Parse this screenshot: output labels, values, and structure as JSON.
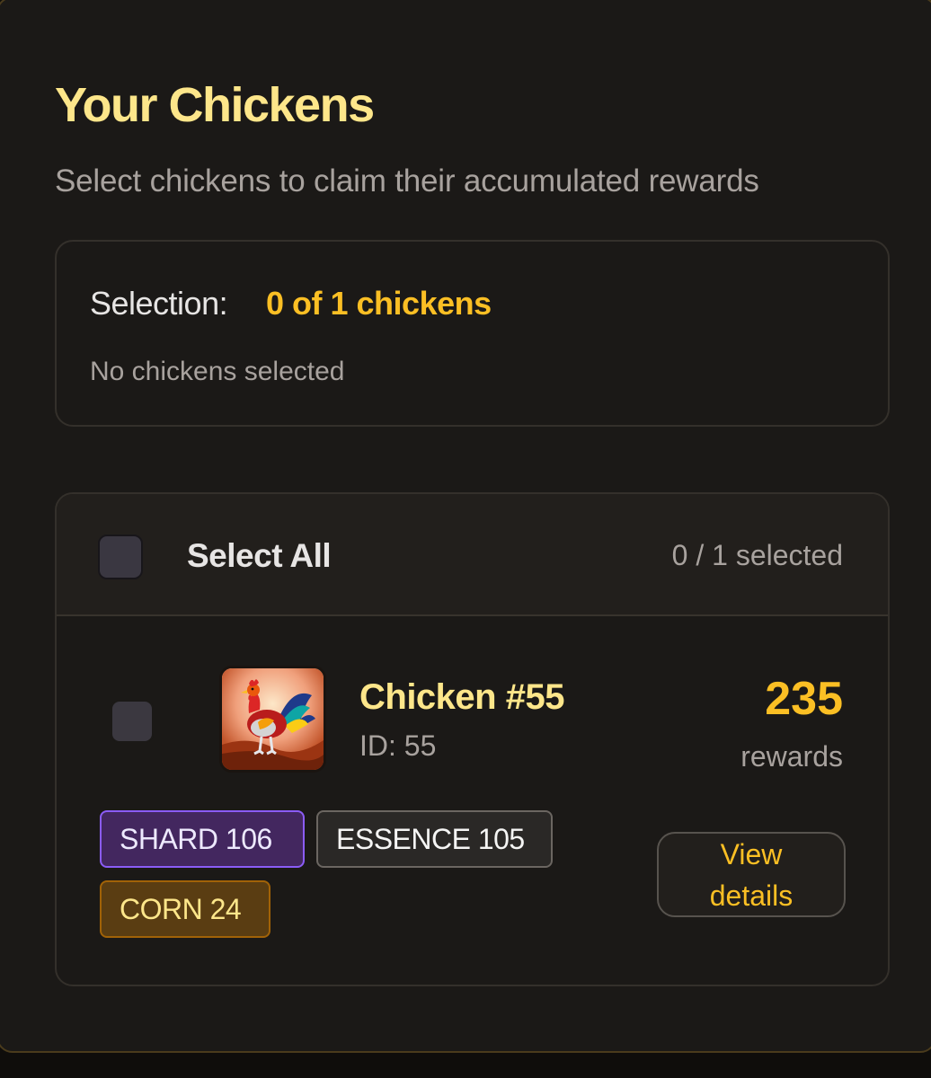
{
  "header": {
    "title": "Your Chickens",
    "subtitle": "Select chickens to claim their accumulated rewards"
  },
  "selection": {
    "label": "Selection:",
    "value": "0 of 1 chickens",
    "empty_text": "No chickens selected"
  },
  "list": {
    "select_all_label": "Select All",
    "selected_count": "0 / 1 selected",
    "chickens": [
      {
        "name": "Chicken #55",
        "id_text": "ID: 55",
        "rewards": "235",
        "rewards_label": "rewards",
        "badges": {
          "shard": "SHARD 106",
          "essence": "ESSENCE 105",
          "corn": "CORN 24"
        },
        "view_details_label": "View details"
      }
    ]
  },
  "colors": {
    "accent": "#fbbf24",
    "title": "#fde68a",
    "shard": "#8b5cf6",
    "corn": "#a16207"
  }
}
